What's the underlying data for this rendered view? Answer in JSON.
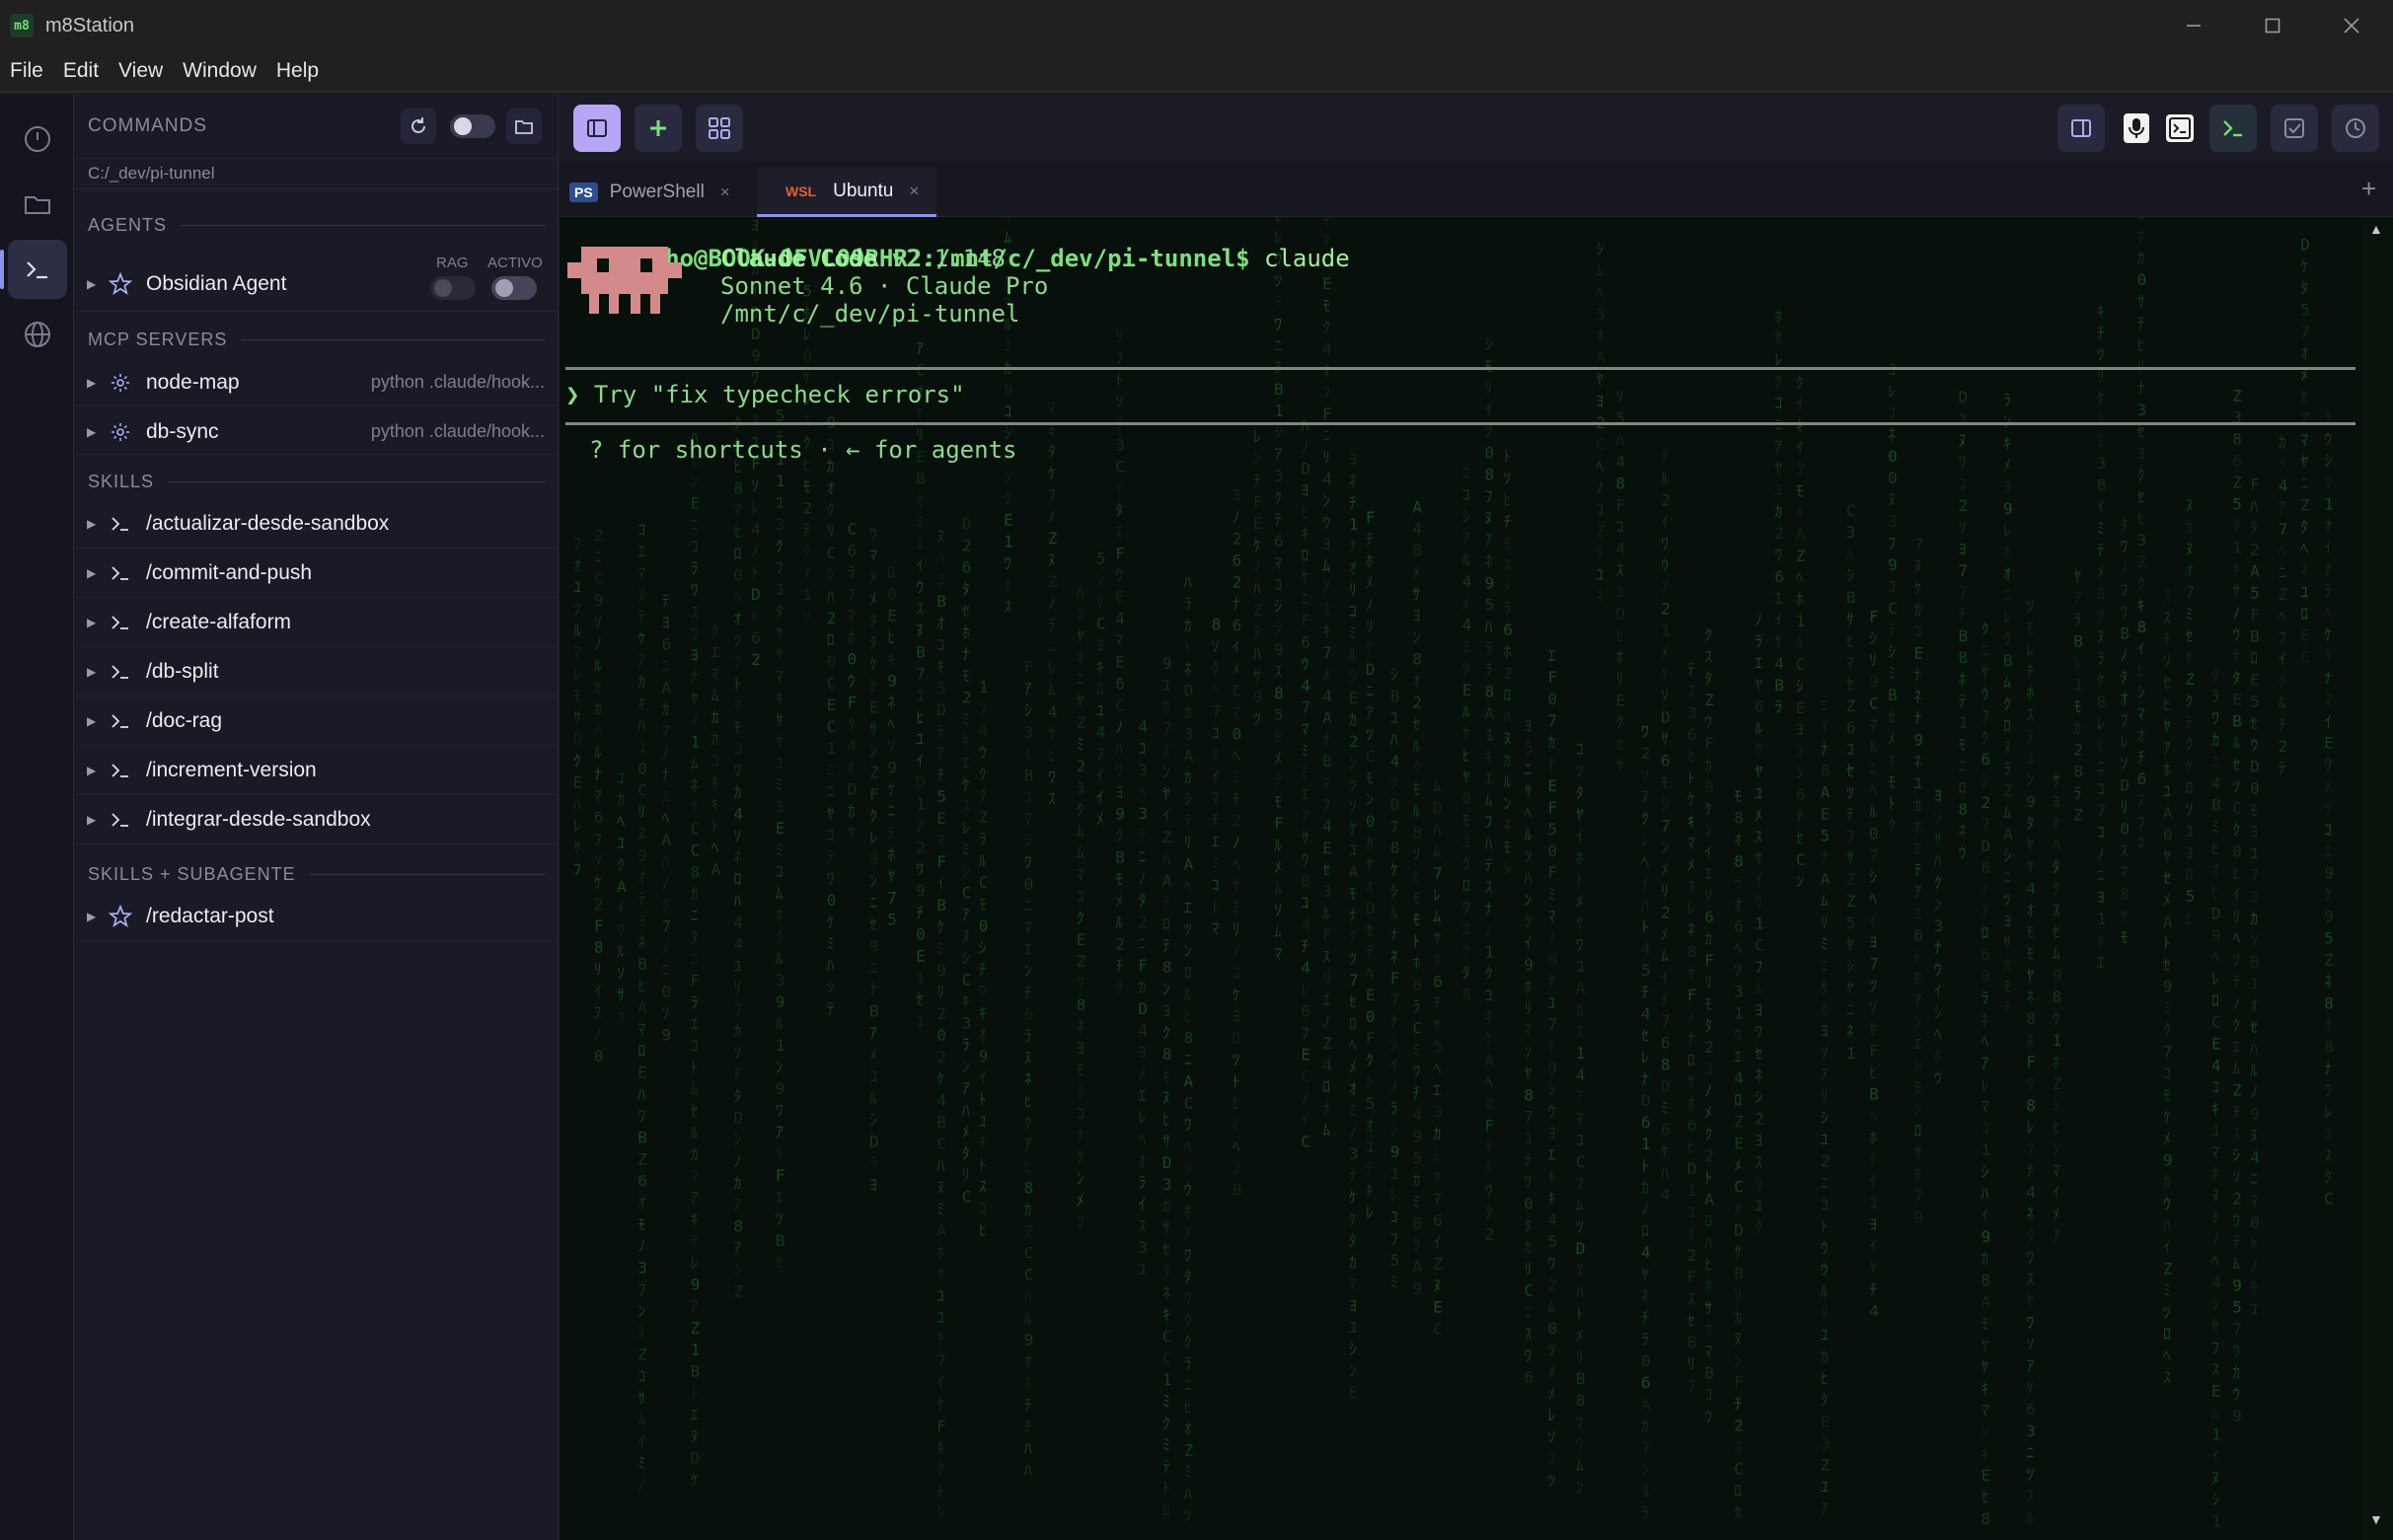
{
  "window": {
    "title": "m8Station",
    "app_icon": "m8",
    "controls": [
      "minimize",
      "maximize",
      "close"
    ]
  },
  "menu": [
    "File",
    "Edit",
    "View",
    "Window",
    "Help"
  ],
  "rail": [
    {
      "name": "history-icon"
    },
    {
      "name": "folder-icon"
    },
    {
      "name": "terminal-icon",
      "active": true
    },
    {
      "name": "globe-icon"
    }
  ],
  "sidebar": {
    "title": "COMMANDS",
    "path": "C:/_dev/pi-tunnel",
    "agents": {
      "label": "AGENTS",
      "columns": [
        "RAG",
        "ACTIVO"
      ],
      "items": [
        {
          "label": "Obsidian Agent",
          "rag": false,
          "activo": false
        }
      ]
    },
    "mcp": {
      "label": "MCP SERVERS",
      "items": [
        {
          "label": "node-map",
          "meta": "python .claude/hook..."
        },
        {
          "label": "db-sync",
          "meta": "python .claude/hook..."
        }
      ]
    },
    "skills": {
      "label": "SKILLS",
      "items": [
        "/actualizar-desde-sandbox",
        "/commit-and-push",
        "/create-alfaform",
        "/db-split",
        "/doc-rag",
        "/increment-version",
        "/integrar-desde-sandbox"
      ]
    },
    "subagent": {
      "label": "SKILLS + SUBAGENTE",
      "items": [
        "/redactar-post"
      ]
    }
  },
  "tabs": [
    {
      "badge": "PS",
      "label": "PowerShell",
      "active": false
    },
    {
      "badge": "WSL",
      "label": "Ubuntu",
      "active": true
    }
  ],
  "terminal": {
    "prompt": "mocho@BOOK-OFVL09RHR2:/mnt/c/_dev/pi-tunnel$",
    "command": " claude",
    "app_name": "Claude Code",
    "version": " v2.1.148",
    "model": "Sonnet 4.6 · Claude Pro",
    "cwd": "/mnt/c/_dev/pi-tunnel",
    "input_prompt": "❯",
    "input_hint": " Try \"fix typecheck errors\"",
    "footer": "? for shortcuts · ← for agents"
  },
  "colors": {
    "accent": "#8b95e8",
    "terminal_green": "#6fe06f",
    "mascot": "#d48a8a"
  }
}
